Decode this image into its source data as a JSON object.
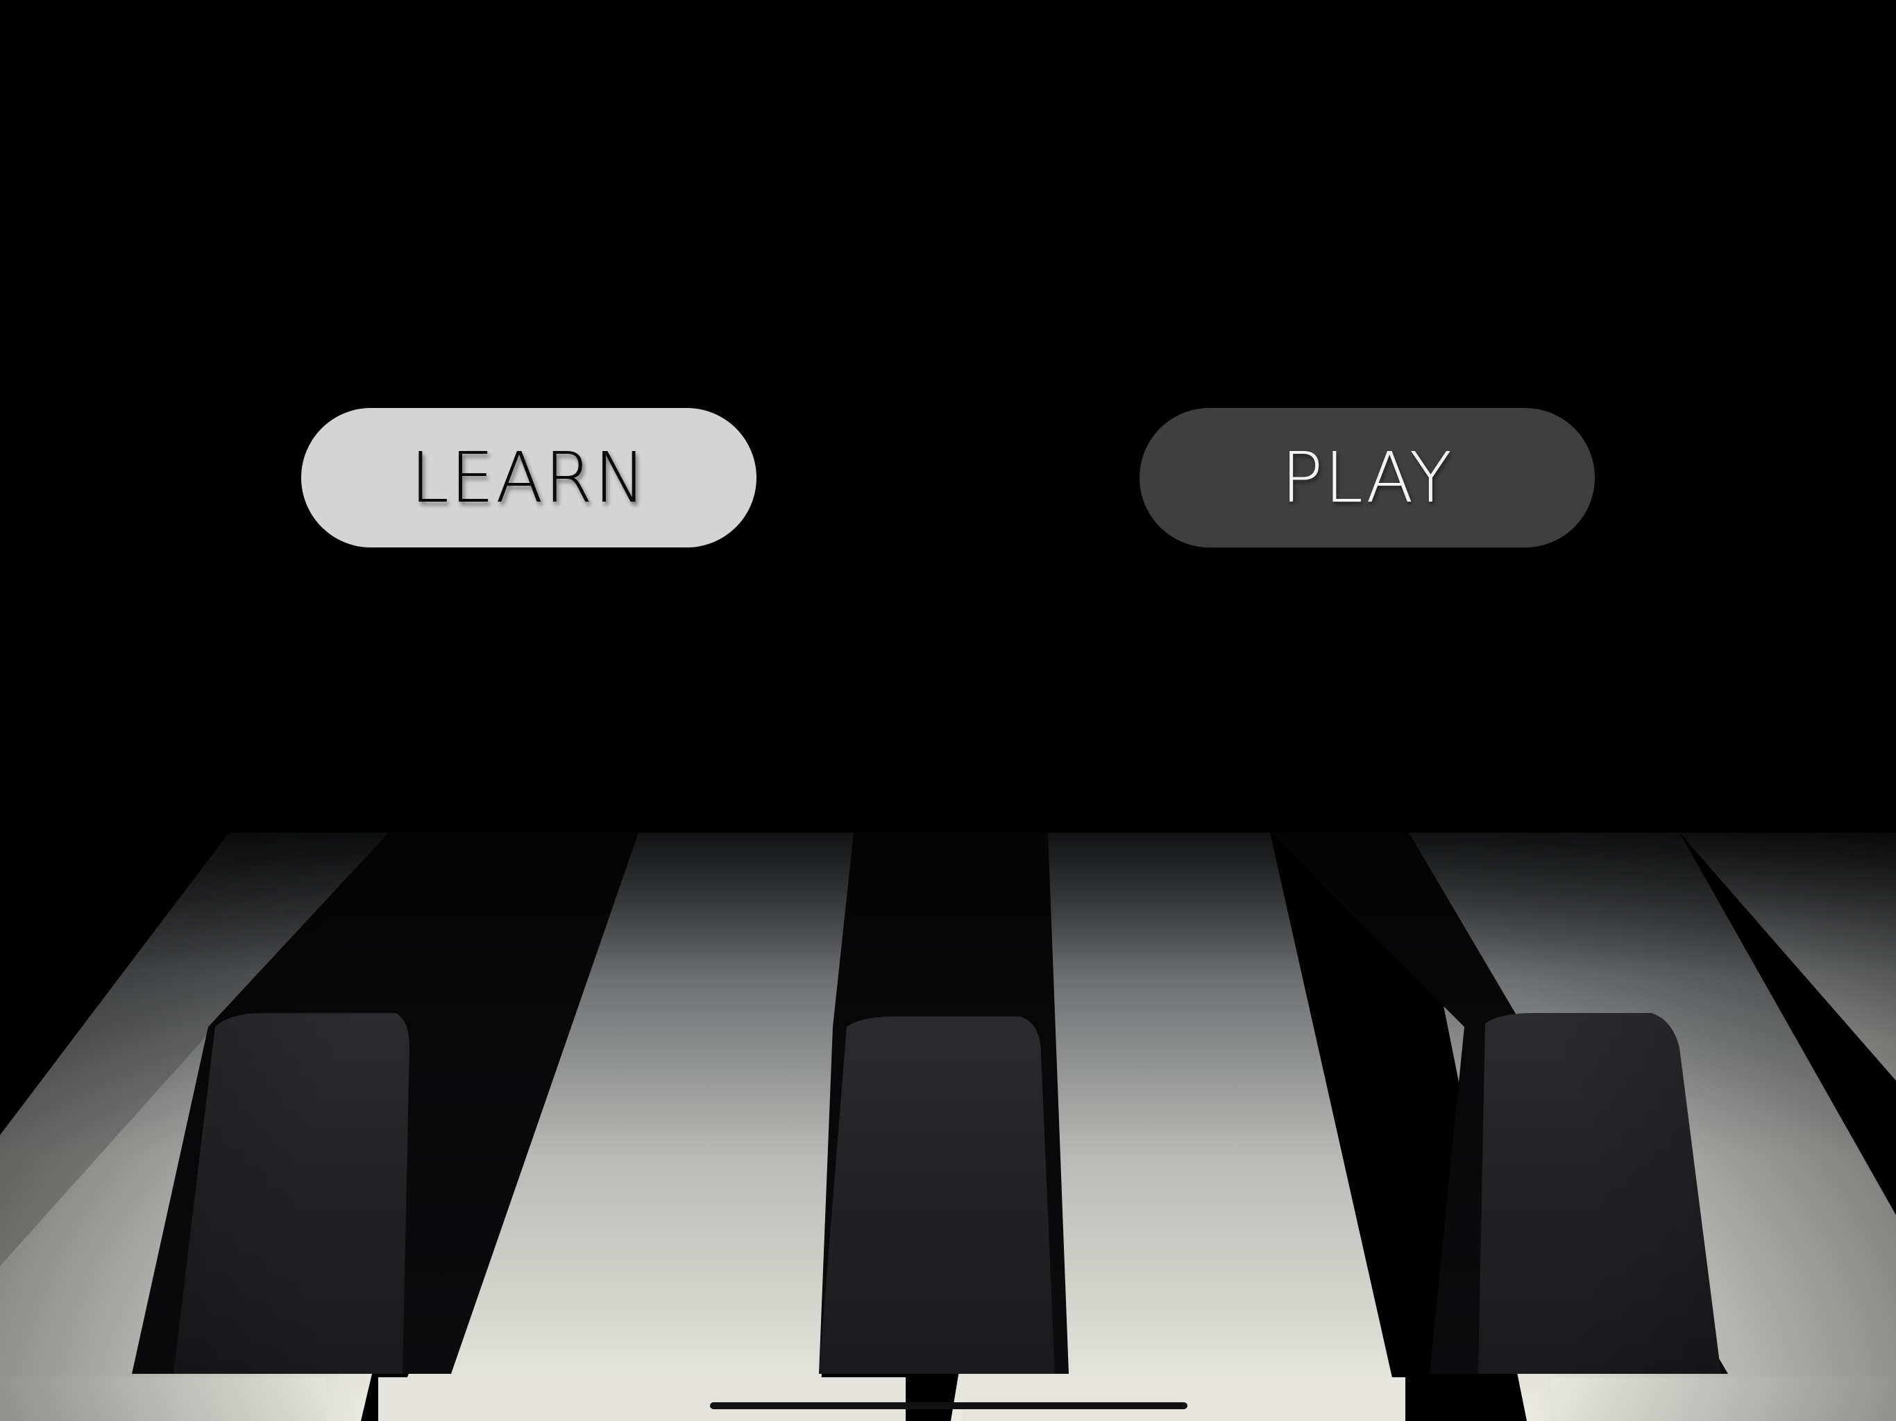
{
  "buttons": {
    "learn_label": "LEARN",
    "play_label": "PLAY"
  },
  "colors": {
    "learn_button_bg": "#d4d4d4",
    "learn_button_text": "#0a0a0a",
    "play_button_bg": "#3f3f3f",
    "play_button_text": "#f4f4f4",
    "background": "#000000",
    "white_key": "#e8e7e1",
    "black_key": "#1c1c1f"
  },
  "background_image": "piano-keys-closeup"
}
